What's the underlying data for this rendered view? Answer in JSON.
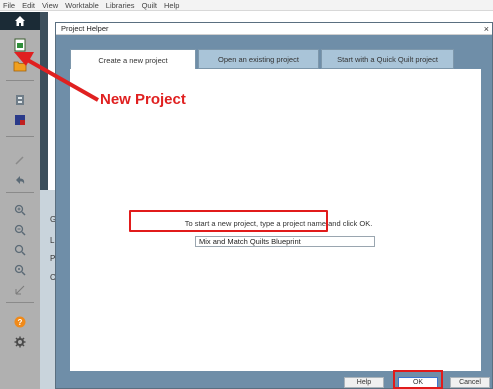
{
  "menu": [
    "File",
    "Edit",
    "View",
    "Worktable",
    "Libraries",
    "Quilt",
    "Help"
  ],
  "toolbar": {
    "icons": [
      "home-icon",
      "new-project-icon",
      "open-project-icon",
      "import-icon",
      "library-icon",
      "pencil-icon",
      "undo-icon",
      "zoom-in-icon",
      "zoom-out-icon",
      "zoom-fit-icon",
      "zoom-actual-icon",
      "rotate-icon",
      "help-icon",
      "settings-icon"
    ]
  },
  "background": {
    "labels": [
      "GI",
      "LE",
      "PI",
      "CC"
    ]
  },
  "dialog": {
    "title": "Project Helper",
    "close": "×",
    "tabs": [
      "Create a new project",
      "Open an existing project",
      "Start with a Quick Quilt project"
    ],
    "instruction": "To start a new project, type a project name and click OK.",
    "project_name": "Mix and Match Quilts Blueprint",
    "buttons": {
      "help": "Help",
      "ok": "OK",
      "cancel": "Cancel"
    }
  },
  "annotation": {
    "text": "New Project",
    "color": "#e02020"
  },
  "colors": {
    "dialog_bg": "#6f8ea8",
    "tab_bg": "#a9c4d8",
    "highlight": "#e11b1b",
    "toolbar": "#b0b0b0"
  }
}
